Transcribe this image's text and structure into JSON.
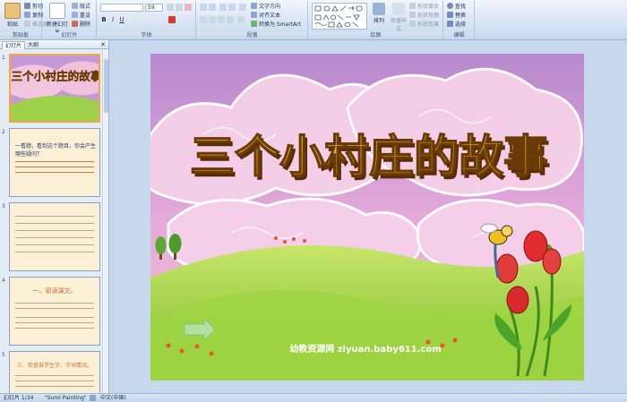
{
  "ribbon": {
    "groups": {
      "clipboard": "剪贴板",
      "slides": "幻灯片",
      "font": "字体",
      "paragraph": "段落",
      "drawing": "绘图",
      "editing": "编辑"
    },
    "clipboard": {
      "paste": "粘贴",
      "cut": "剪切",
      "copy": "复制",
      "format_painter": "格式刷"
    },
    "slides": {
      "new_slide": "新建幻灯片",
      "layout": "版式",
      "reset": "重设",
      "delete": "删除"
    },
    "font": {
      "size": "59"
    },
    "paragraph": {
      "text_direction": "文字方向",
      "align_text": "对齐文本",
      "smartart": "转换为 SmartArt"
    },
    "drawing": {
      "arrange": "排列",
      "quick_styles": "快速样式",
      "shape_fill": "形状填充",
      "shape_outline": "形状轮廓",
      "shape_effects": "形状效果"
    },
    "editing": {
      "find": "查找",
      "replace": "替换",
      "select": "选择"
    }
  },
  "leftpane": {
    "tabs": [
      "幻灯片",
      "大纲"
    ],
    "slides": [
      {
        "num": "1",
        "title": "三个小村庄的故事"
      },
      {
        "num": "2",
        "title": "一看题，看到这个题目，你会产生哪些疑问？"
      },
      {
        "num": "3",
        "title": ""
      },
      {
        "num": "4",
        "title": "一、初读课文。"
      },
      {
        "num": "5",
        "title": "三、检查自学生字、字词情况。"
      }
    ]
  },
  "slide": {
    "title": "三个小村庄的故事",
    "watermark": "幼教资源网 ziyuan.baby611.com"
  },
  "status": {
    "slide_count": "幻灯片 1/34",
    "theme": "\"Sumi Painting\"",
    "language": "中文(中国)"
  },
  "colors": {
    "sky_top": "#b98bd0",
    "sky_bottom": "#f3b7d8",
    "grass": "#8fca3a",
    "title_fill": "#d8a11a"
  }
}
